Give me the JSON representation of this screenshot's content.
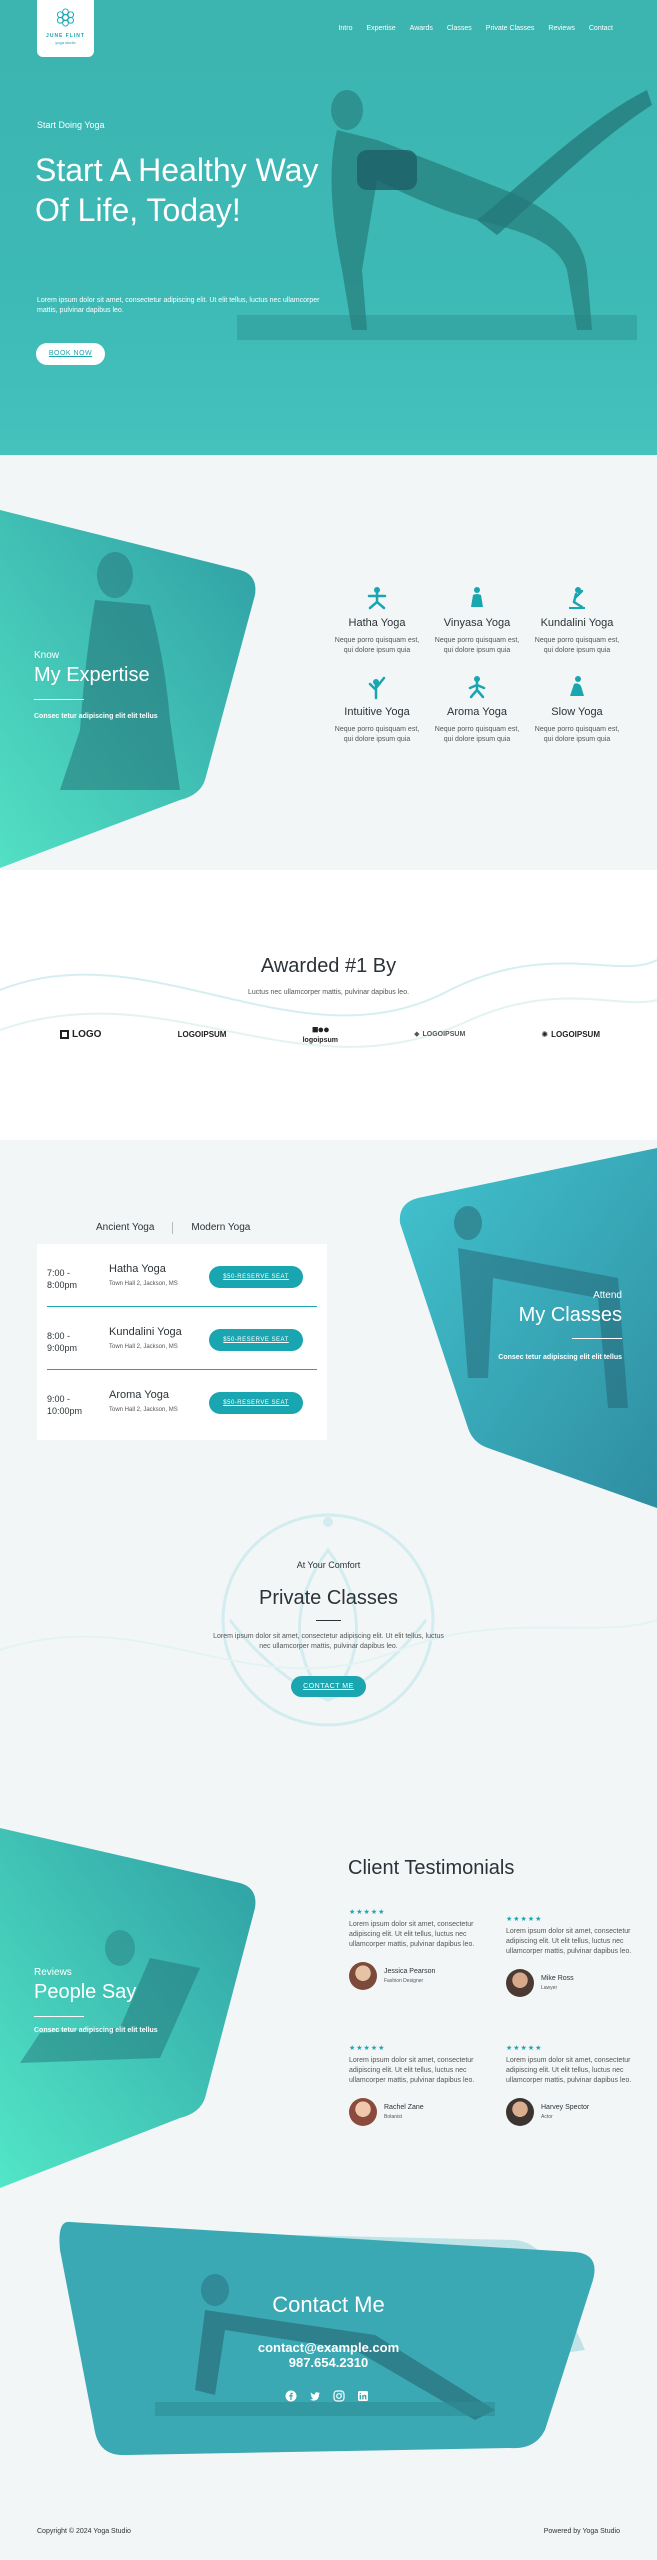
{
  "brand": {
    "name": "JUNE FLINT",
    "tagline": "yoga studio"
  },
  "nav": [
    "Intro",
    "Expertise",
    "Awards",
    "Classes",
    "Private Classes",
    "Reviews",
    "Contact"
  ],
  "hero": {
    "eyebrow": "Start Doing Yoga",
    "title": "Start A Healthy Way Of Life, Today!",
    "text": "Lorem ipsum dolor sit amet, consectetur adipiscing elit. Ut elit tellus, luctus nec ullamcorper mattis, pulvinar dapibus leo.",
    "button": "Book Now"
  },
  "expertise": {
    "eyebrow": "Know",
    "title": "My Expertise",
    "text": "Consec tetur adipiscing elit elit tellus",
    "items": [
      {
        "name": "Hatha Yoga",
        "desc": "Neque porro quisquam est, qui dolore ipsum quia",
        "icon": "hatha-pose-icon"
      },
      {
        "name": "Vinyasa Yoga",
        "desc": "Neque porro quisquam est, qui dolore ipsum quia",
        "icon": "vinyasa-pose-icon"
      },
      {
        "name": "Kundalini Yoga",
        "desc": "Neque porro quisquam est, qui dolore ipsum quia",
        "icon": "kundalini-pose-icon"
      },
      {
        "name": "Intuitive Yoga",
        "desc": "Neque porro quisquam est, qui dolore ipsum quia",
        "icon": "intuitive-pose-icon"
      },
      {
        "name": "Aroma Yoga",
        "desc": "Neque porro quisquam est, qui dolore ipsum quia",
        "icon": "aroma-pose-icon"
      },
      {
        "name": "Slow Yoga",
        "desc": "Neque porro quisquam est, qui dolore ipsum quia",
        "icon": "slow-pose-icon"
      }
    ]
  },
  "awards": {
    "title": "Awarded #1 By",
    "subtitle": "Luctus nec ullamcorper mattis, pulvinar dapibus leo.",
    "logos": [
      "LOGO",
      "LOGOIPSUM",
      "logoipsum",
      "LOGOIPSUM",
      "LOGOIPSUM"
    ]
  },
  "classes": {
    "tabs": [
      "Ancient Yoga",
      "Modern Yoga"
    ],
    "rows": [
      {
        "time": "7:00 - 8:00pm",
        "name": "Hatha Yoga",
        "location": "Town Hall 2, Jackson, MS",
        "button": "$50-Reserve Seat"
      },
      {
        "time": "8:00 - 9:00pm",
        "name": "Kundalini Yoga",
        "location": "Town Hall 2, Jackson, MS",
        "button": "$50-Reserve Seat"
      },
      {
        "time": "9:00 - 10:00pm",
        "name": "Aroma Yoga",
        "location": "Town Hall 2, Jackson, MS",
        "button": "$50-Reserve Seat"
      }
    ],
    "eyebrow": "Attend",
    "title": "My Classes",
    "text": "Consec tetur adipiscing elit elit tellus"
  },
  "private": {
    "eyebrow": "At Your Comfort",
    "title": "Private Classes",
    "text": "Lorem ipsum dolor sit amet, consectetur adipiscing elit. Ut elit tellus, luctus nec ullamcorper mattis, pulvinar dapibus leo.",
    "button": "Contact Me"
  },
  "reviews": {
    "eyebrow": "Reviews",
    "title": "People Say",
    "text": "Consec tetur adipiscing elit elit tellus",
    "heading": "Client Testimonials",
    "items": [
      {
        "stars": "★★★★★",
        "quote": "Lorem ipsum dolor sit amet, consectetur adipiscing elit. Ut elit tellus, luctus nec ullamcorper mattis, pulvinar dapibus leo.",
        "name": "Jessica Pearson",
        "role": "Fashion Designer"
      },
      {
        "stars": "★★★★★",
        "quote": "Lorem ipsum dolor sit amet, consectetur adipiscing elit. Ut elit tellus, luctus nec ullamcorper mattis, pulvinar dapibus leo.",
        "name": "Mike Ross",
        "role": "Lawyer"
      },
      {
        "stars": "★★★★★",
        "quote": "Lorem ipsum dolor sit amet, consectetur adipiscing elit. Ut elit tellus, luctus nec ullamcorper mattis, pulvinar dapibus leo.",
        "name": "Rachel Zane",
        "role": "Botanist"
      },
      {
        "stars": "★★★★★",
        "quote": "Lorem ipsum dolor sit amet, consectetur adipiscing elit. Ut elit tellus, luctus nec ullamcorper mattis, pulvinar dapibus leo.",
        "name": "Harvey Spector",
        "role": "Actor"
      }
    ]
  },
  "contact": {
    "title": "Contact Me",
    "email": "contact@example.com",
    "phone": "987.654.2310",
    "socials": [
      "facebook-icon",
      "twitter-icon",
      "instagram-icon",
      "linkedin-icon"
    ]
  },
  "footer": {
    "left": "Copyright © 2024 Yoga Studio",
    "right": "Powered by Yoga Studio"
  },
  "colors": {
    "teal": "#1aa6b0",
    "hero": "#3db9b5",
    "bg": "#f3f6f7"
  }
}
